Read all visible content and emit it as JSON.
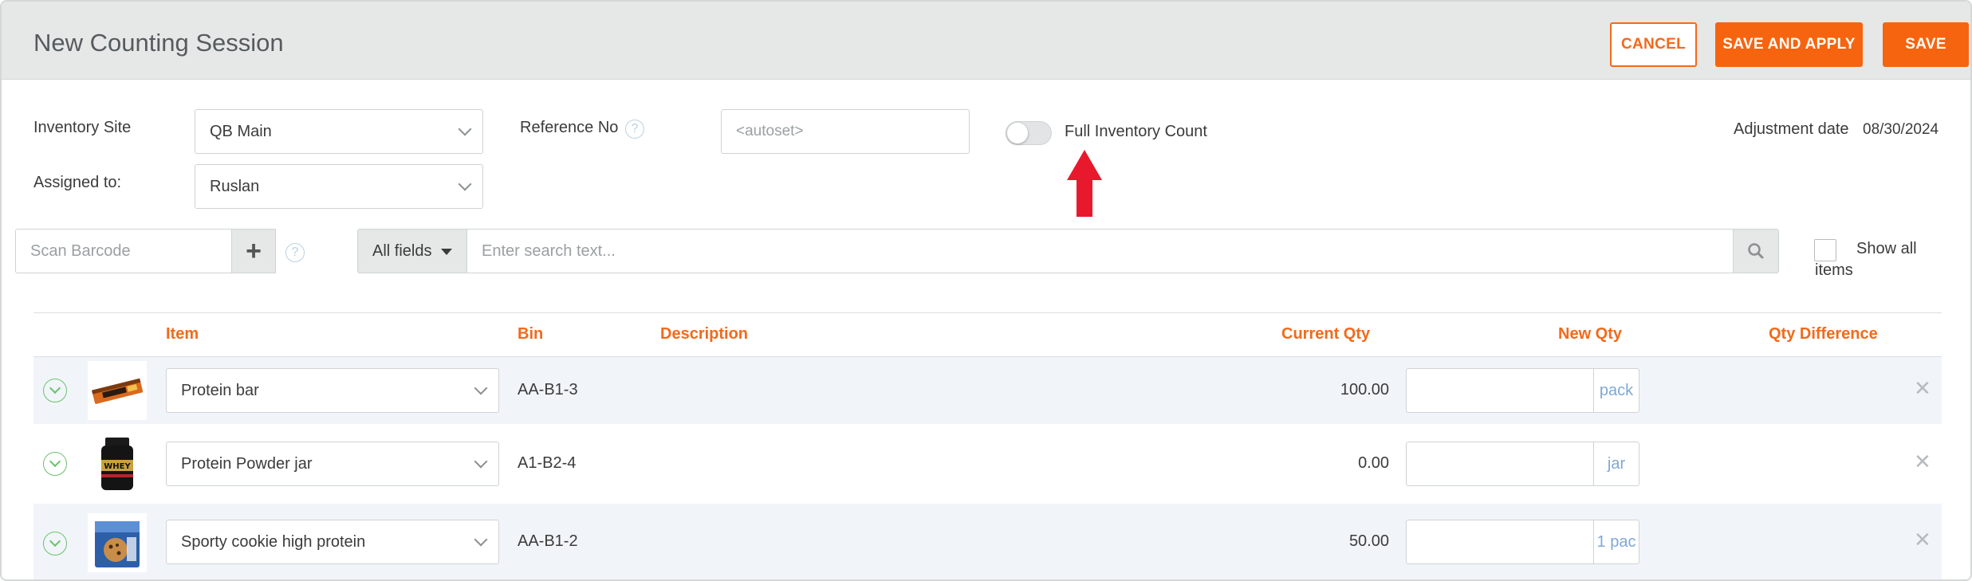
{
  "header": {
    "title": "New Counting Session",
    "cancel_label": "CANCEL",
    "save_apply_label": "SAVE AND APPLY",
    "save_label": "SAVE"
  },
  "form": {
    "inventory_site_label": "Inventory Site",
    "inventory_site_value": "QB Main",
    "assigned_to_label": "Assigned to:",
    "assigned_to_value": "Ruslan",
    "reference_no_label": "Reference No",
    "reference_no_placeholder": "<autoset>",
    "full_inventory_label": "Full Inventory Count",
    "full_inventory_on": false,
    "adjustment_date_label": "Adjustment date",
    "adjustment_date_value": "08/30/2024"
  },
  "toolbar": {
    "scan_placeholder": "Scan Barcode",
    "fields_select": "All fields",
    "search_placeholder": "Enter search text...",
    "show_all_label": "Show all items"
  },
  "table": {
    "columns": {
      "item": "Item",
      "bin": "Bin",
      "description": "Description",
      "current_qty": "Current Qty",
      "new_qty": "New Qty",
      "qty_difference": "Qty Difference"
    },
    "rows": [
      {
        "item": "Protein bar",
        "bin": "AA-B1-3",
        "description": "",
        "current_qty": "100.00",
        "new_qty": "",
        "unit": "pack",
        "qty_difference": ""
      },
      {
        "item": "Protein Powder jar",
        "bin": "A1-B2-4",
        "description": "",
        "current_qty": "0.00",
        "new_qty": "",
        "unit": "jar",
        "qty_difference": ""
      },
      {
        "item": "Sporty cookie high protein",
        "bin": "AA-B1-2",
        "description": "",
        "current_qty": "50.00",
        "new_qty": "",
        "unit": "1 pac",
        "qty_difference": ""
      }
    ]
  },
  "colors": {
    "accent": "#f7640f",
    "header_bg": "#e6e8e7",
    "row_alt": "#f1f5fa",
    "arrow": "#e8192c"
  }
}
